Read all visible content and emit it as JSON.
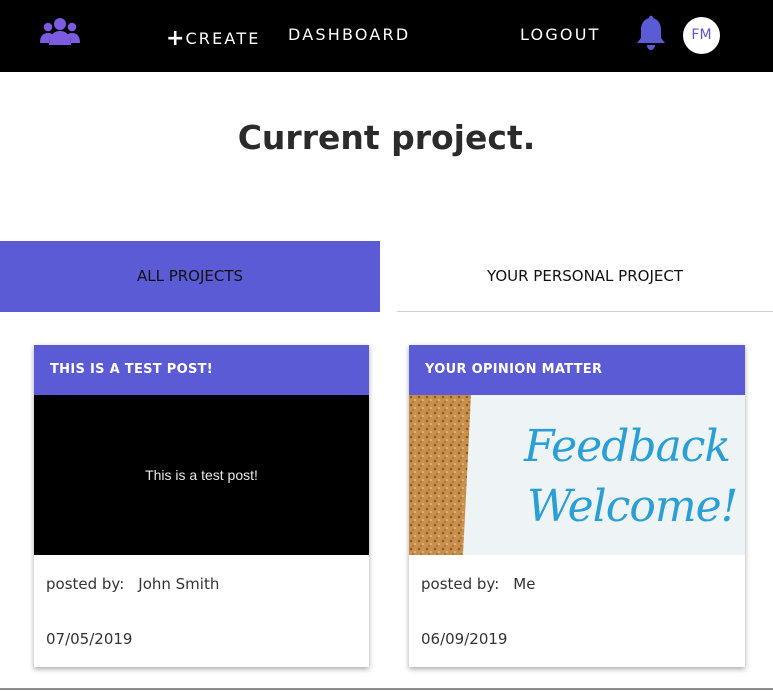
{
  "brand": {
    "icon": "people-group-icon",
    "color": "#7d5be0"
  },
  "nav": {
    "create_prefix": "+",
    "create_label": "CREATE",
    "dashboard_label": "DASHBOARD",
    "logout_label": "LOGOUT",
    "notification_icon": "bell-icon",
    "avatar_initials": "FM"
  },
  "page": {
    "title": "Current project."
  },
  "tabs": [
    {
      "label": "ALL PROJECTS",
      "active": true
    },
    {
      "label": "YOUR PERSONAL PROJECT",
      "active": false
    }
  ],
  "colors": {
    "accent": "#5b5bd6",
    "navbar": "#000000",
    "feedback_text": "#2a9fd6"
  },
  "posts": [
    {
      "title": "THIS IS A TEST POST!",
      "image_caption": "This is a test post!",
      "posted_by_label": "posted by:",
      "author": "John Smith",
      "date": "07/05/2019"
    },
    {
      "title": "YOUR OPINION MATTER",
      "image_text_line1": "Feedback",
      "image_text_line2": "Welcome!",
      "posted_by_label": "posted by:",
      "author": "Me",
      "date": "06/09/2019"
    }
  ]
}
